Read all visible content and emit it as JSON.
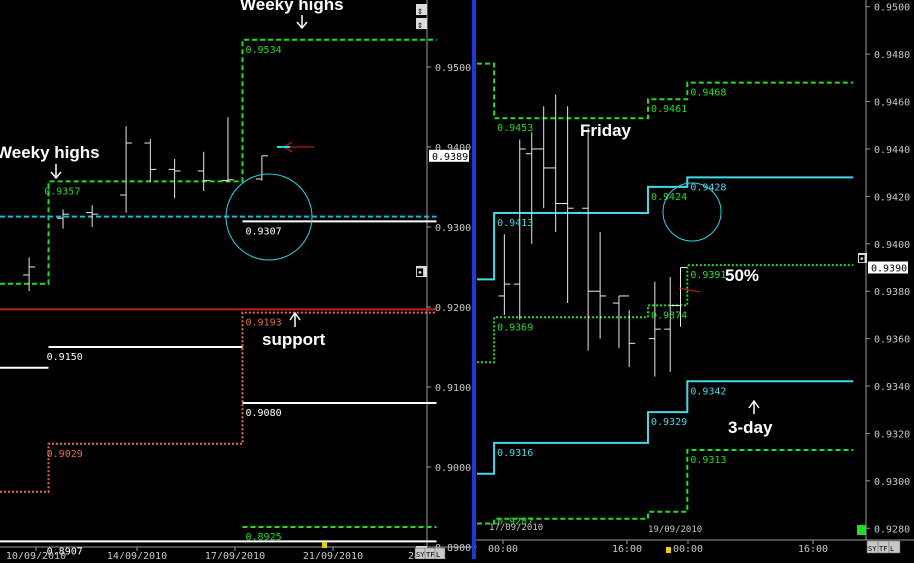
{
  "left_chart": {
    "ticks": [
      "0.9500",
      "0.9400",
      "0.9300",
      "0.9200",
      "0.9100",
      "0.9000",
      "0.8900"
    ],
    "x_labels": [
      "10/09/2010",
      "14/09/2010",
      "17/09/2010",
      "21/09/2010",
      "24/0"
    ],
    "price_badge": "0.9389",
    "annotations": {
      "weekly_highs_top": "Weeky highs",
      "weekly_highs_left": "Weeky highs",
      "support": "support"
    },
    "level_labels": [
      {
        "text": "0.9534",
        "color": "#22dd22",
        "value": 0.9534
      },
      {
        "text": "0.9357",
        "color": "#22dd22",
        "value": 0.9357
      },
      {
        "text": "0.9307",
        "color": "#ffffff",
        "value": 0.9307
      },
      {
        "text": "0.9193",
        "color": "#e86a4a",
        "value": 0.9193
      },
      {
        "text": "0.9150",
        "color": "#ffffff",
        "value": 0.915
      },
      {
        "text": "0.9080",
        "color": "#ffffff",
        "value": 0.908
      },
      {
        "text": "0.9029",
        "color": "#e86a4a",
        "value": 0.9029
      },
      {
        "text": "0.8925",
        "color": "#22dd22",
        "value": 0.8925
      },
      {
        "text": "0.8907",
        "color": "#ffffff",
        "value": 0.8907
      }
    ],
    "scroll_glyphs": [
      "⇕",
      "⇕",
      "◘",
      "▯"
    ],
    "buttons": [
      "SY",
      "TF",
      "L"
    ]
  },
  "right_chart": {
    "ticks": [
      "0.9500",
      "0.9480",
      "0.9460",
      "0.9440",
      "0.9420",
      "0.9400",
      "0.9380",
      "0.9360",
      "0.9340",
      "0.9320",
      "0.9300",
      "0.9280"
    ],
    "x_labels": [
      "00:00",
      "16:00",
      "00:00",
      "16:00"
    ],
    "date_labels": [
      "17/09/2010",
      "19/09/2010"
    ],
    "price_badge": "0.9390",
    "annotations": {
      "friday": "Friday",
      "fifty": "50%",
      "three_day": "3-day"
    },
    "level_labels": [
      {
        "text": "0.9468",
        "color": "#22dd22",
        "value": 0.9468
      },
      {
        "text": "0.9461",
        "color": "#22dd22",
        "value": 0.9461
      },
      {
        "text": "0.9453",
        "color": "#22dd22",
        "value": 0.9453
      },
      {
        "text": "0.9428",
        "color": "#44d8e8",
        "value": 0.9428
      },
      {
        "text": "0.9424",
        "color": "#22dd22",
        "value": 0.9424
      },
      {
        "text": "0.9413",
        "color": "#44d8e8",
        "value": 0.9413
      },
      {
        "text": "0.9391",
        "color": "#22dd22",
        "value": 0.9391
      },
      {
        "text": "0.9374",
        "color": "#22dd22",
        "value": 0.9374
      },
      {
        "text": "0.9369",
        "color": "#22dd22",
        "value": 0.9369
      },
      {
        "text": "0.9342",
        "color": "#44d8e8",
        "value": 0.9342
      },
      {
        "text": "0.9329",
        "color": "#44d8e8",
        "value": 0.9329
      },
      {
        "text": "0.9316",
        "color": "#44d8e8",
        "value": 0.9316
      },
      {
        "text": "0.9313",
        "color": "#22dd22",
        "value": 0.9313
      },
      {
        "text": "0.9287",
        "color": "#22dd22",
        "value": 0.9287
      }
    ],
    "buttons": [
      "SY",
      "TF",
      "L"
    ]
  },
  "chart_data": [
    {
      "type": "line",
      "ylim": [
        0.89,
        0.955
      ],
      "x_ticks": [
        "10/09/2010",
        "14/09/2010",
        "17/09/2010",
        "21/09/2010",
        "24/0"
      ],
      "series": [
        {
          "name": "",
          "color": "#22dd22",
          "style": "dashed",
          "points": [
            [
              0,
              0.9229
            ],
            [
              1,
              0.9229
            ],
            [
              1,
              0.9357
            ],
            [
              5,
              0.9357
            ],
            [
              5,
              0.9534
            ],
            [
              9,
              0.9534
            ]
          ]
        },
        {
          "name": "",
          "color": "#19b8d8",
          "style": "dashed",
          "points": [
            [
              0,
              0.9313
            ],
            [
              9,
              0.9313
            ]
          ]
        },
        {
          "name": "",
          "color": "#ffffff",
          "style": "solid",
          "points": [
            [
              5,
              0.9307
            ],
            [
              9,
              0.9307
            ]
          ]
        },
        {
          "name": "",
          "color": "#c02020",
          "style": "solid",
          "points": [
            [
              0,
              0.9197
            ],
            [
              9,
              0.9197
            ]
          ]
        },
        {
          "name": "",
          "color": "#e86a4a",
          "style": "dotted",
          "points": [
            [
              0,
              0.8969
            ],
            [
              1,
              0.8969
            ],
            [
              1,
              0.9029
            ],
            [
              5,
              0.9029
            ],
            [
              5,
              0.9193
            ],
            [
              9,
              0.9193
            ]
          ]
        },
        {
          "name": "",
          "color": "#ffffff",
          "style": "solid",
          "points": [
            [
              1,
              0.915
            ],
            [
              5,
              0.915
            ]
          ]
        },
        {
          "name": "",
          "color": "#ffffff",
          "style": "solid",
          "points": [
            [
              0,
              0.9124
            ],
            [
              1,
              0.9124
            ]
          ]
        },
        {
          "name": "",
          "color": "#ffffff",
          "style": "solid",
          "points": [
            [
              5,
              0.908
            ],
            [
              9,
              0.908
            ]
          ]
        },
        {
          "name": "",
          "color": "#22dd22",
          "style": "dashed",
          "points": [
            [
              5,
              0.8925
            ],
            [
              9,
              0.8925
            ]
          ]
        },
        {
          "name": "",
          "color": "#ffffff",
          "style": "solid",
          "points": [
            [
              0,
              0.8907
            ],
            [
              9,
              0.8907
            ]
          ]
        }
      ],
      "ohlc": [
        {
          "x": 0.6,
          "high": 0.9262,
          "low": 0.922,
          "open": 0.924,
          "close": 0.925
        },
        {
          "x": 1.3,
          "high": 0.9322,
          "low": 0.9298,
          "open": 0.9311,
          "close": 0.9316
        },
        {
          "x": 1.9,
          "high": 0.9327,
          "low": 0.93,
          "open": 0.9318,
          "close": 0.9316
        },
        {
          "x": 2.6,
          "high": 0.9426,
          "low": 0.9318,
          "open": 0.934,
          "close": 0.9405
        },
        {
          "x": 3.1,
          "high": 0.941,
          "low": 0.9356,
          "open": 0.9405,
          "close": 0.9372
        },
        {
          "x": 3.6,
          "high": 0.9385,
          "low": 0.9336,
          "open": 0.9372,
          "close": 0.937
        },
        {
          "x": 4.2,
          "high": 0.9394,
          "low": 0.9345,
          "open": 0.937,
          "close": 0.9358
        },
        {
          "x": 4.7,
          "high": 0.9437,
          "low": 0.9356,
          "open": 0.9358,
          "close": 0.9359
        },
        {
          "x": 5.4,
          "high": 0.9389,
          "low": 0.9358,
          "open": 0.936,
          "close": 0.9389
        }
      ]
    },
    {
      "type": "line",
      "ylim": [
        0.9278,
        0.9502
      ],
      "x_ticks": [
        "00:00",
        "16:00",
        "00:00",
        "16:00"
      ],
      "series": [
        {
          "name": "",
          "color": "#22dd22",
          "style": "dashed",
          "points": [
            [
              0,
              0.9476
            ],
            [
              1,
              0.9476
            ],
            [
              1,
              0.9453
            ],
            [
              10,
              0.9453
            ],
            [
              10,
              0.9461
            ],
            [
              12.3,
              0.9461
            ],
            [
              12.3,
              0.9468
            ],
            [
              22,
              0.9468
            ]
          ]
        },
        {
          "name": "",
          "color": "#44d8e8",
          "style": "solid",
          "points": [
            [
              0,
              0.9385
            ],
            [
              1,
              0.9385
            ],
            [
              1,
              0.9413
            ],
            [
              10,
              0.9413
            ],
            [
              10,
              0.9424
            ],
            [
              12.3,
              0.9424
            ],
            [
              12.3,
              0.9428
            ],
            [
              22,
              0.9428
            ]
          ]
        },
        {
          "name": "",
          "color": "#22dd22",
          "style": "dotted",
          "points": [
            [
              0,
              0.935
            ],
            [
              1,
              0.935
            ],
            [
              1,
              0.9369
            ],
            [
              10,
              0.9369
            ],
            [
              10,
              0.9374
            ],
            [
              12.3,
              0.9374
            ],
            [
              12.3,
              0.9391
            ],
            [
              22,
              0.9391
            ]
          ]
        },
        {
          "name": "",
          "color": "#44d8e8",
          "style": "solid",
          "points": [
            [
              0,
              0.9303
            ],
            [
              1,
              0.9303
            ],
            [
              1,
              0.9316
            ],
            [
              10,
              0.9316
            ],
            [
              10,
              0.9329
            ],
            [
              12.3,
              0.9329
            ],
            [
              12.3,
              0.9342
            ],
            [
              22,
              0.9342
            ]
          ]
        },
        {
          "name": "",
          "color": "#22dd22",
          "style": "dashed",
          "points": [
            [
              0,
              0.9282
            ],
            [
              1,
              0.9282
            ],
            [
              1,
              0.9284
            ],
            [
              10,
              0.9284
            ],
            [
              10,
              0.9287
            ],
            [
              12.3,
              0.9287
            ],
            [
              12.3,
              0.9313
            ],
            [
              22,
              0.9313
            ]
          ]
        }
      ],
      "ohlc": [
        {
          "x": 1.6,
          "high": 0.9404,
          "low": 0.937,
          "open": 0.9378,
          "close": 0.9383
        },
        {
          "x": 2.5,
          "high": 0.9444,
          "low": 0.9368,
          "open": 0.9383,
          "close": 0.944
        },
        {
          "x": 3.2,
          "high": 0.9447,
          "low": 0.94,
          "open": 0.9438,
          "close": 0.944
        },
        {
          "x": 3.9,
          "high": 0.9458,
          "low": 0.9415,
          "open": 0.944,
          "close": 0.9432
        },
        {
          "x": 4.6,
          "high": 0.9463,
          "low": 0.9405,
          "open": 0.9432,
          "close": 0.9417
        },
        {
          "x": 5.3,
          "high": 0.9458,
          "low": 0.9375,
          "open": 0.9417,
          "close": 0.9415
        },
        {
          "x": 6.5,
          "high": 0.9449,
          "low": 0.9355,
          "open": 0.9415,
          "close": 0.938
        },
        {
          "x": 7.2,
          "high": 0.9405,
          "low": 0.936,
          "open": 0.938,
          "close": 0.9378
        },
        {
          "x": 8.3,
          "high": 0.9378,
          "low": 0.9356,
          "open": 0.9375,
          "close": 0.9378
        },
        {
          "x": 8.9,
          "high": 0.9372,
          "low": 0.9348,
          "open": 0.9378,
          "close": 0.9358
        },
        {
          "x": 10.4,
          "high": 0.9384,
          "low": 0.9344,
          "open": 0.936,
          "close": 0.9364
        },
        {
          "x": 11.3,
          "high": 0.9386,
          "low": 0.9346,
          "open": 0.9364,
          "close": 0.9374
        },
        {
          "x": 11.9,
          "high": 0.939,
          "low": 0.9365,
          "open": 0.9374,
          "close": 0.939
        }
      ]
    }
  ]
}
